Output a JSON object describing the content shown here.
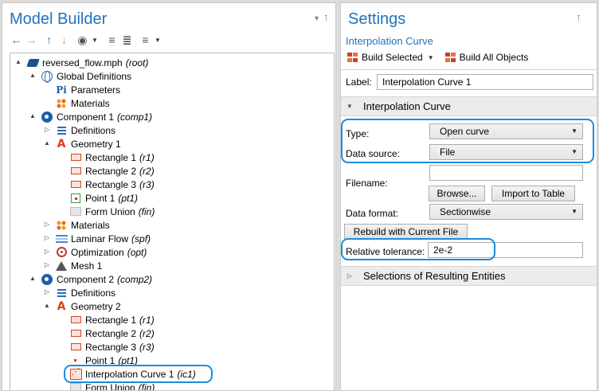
{
  "model_builder": {
    "title": "Model Builder",
    "toolbar": [
      {
        "icon": "arrow-left-icon",
        "glyph": "←"
      },
      {
        "icon": "arrow-right-icon",
        "glyph": "→"
      },
      {
        "icon": "arrow-up-icon",
        "glyph": "↑"
      },
      {
        "icon": "arrow-down-icon",
        "glyph": "↓"
      },
      {
        "icon": "show-icon",
        "glyph": "◉"
      },
      {
        "icon": "expand-sections-icon",
        "glyph": "≡"
      },
      {
        "icon": "collapse-sections-icon",
        "glyph": "≣"
      },
      {
        "icon": "list-view-icon",
        "glyph": "≡"
      }
    ],
    "tree": [
      {
        "label": "reversed_flow.mph",
        "tag": "(root)",
        "icon": "root-icon",
        "toggle": "▲"
      },
      {
        "label": "Global Definitions",
        "tag": "",
        "icon": "globe-icon",
        "toggle": "▲"
      },
      {
        "label": "Parameters",
        "tag": "",
        "icon": "parameters-icon",
        "toggle": ""
      },
      {
        "label": "Materials",
        "tag": "",
        "icon": "materials-icon",
        "toggle": ""
      },
      {
        "label": "Component 1",
        "tag": "(comp1)",
        "icon": "component-icon",
        "toggle": "▲"
      },
      {
        "label": "Definitions",
        "tag": "",
        "icon": "definitions-icon",
        "toggle": "▷"
      },
      {
        "label": "Geometry 1",
        "tag": "",
        "icon": "geometry-icon",
        "toggle": "▲"
      },
      {
        "label": "Rectangle 1",
        "tag": "(r1)",
        "icon": "rectangle-icon",
        "toggle": ""
      },
      {
        "label": "Rectangle 2",
        "tag": "(r2)",
        "icon": "rectangle-icon",
        "toggle": ""
      },
      {
        "label": "Rectangle 3",
        "tag": "(r3)",
        "icon": "rectangle-icon",
        "toggle": ""
      },
      {
        "label": "Point 1",
        "tag": "(pt1)",
        "icon": "point-icon",
        "toggle": ""
      },
      {
        "label": "Form Union",
        "tag": "(fin)",
        "icon": "form-union-icon",
        "toggle": ""
      },
      {
        "label": "Materials",
        "tag": "",
        "icon": "materials-icon",
        "toggle": "▷"
      },
      {
        "label": "Laminar Flow",
        "tag": "(spf)",
        "icon": "laminar-flow-icon",
        "toggle": "▷"
      },
      {
        "label": "Optimization",
        "tag": "(opt)",
        "icon": "optimization-icon",
        "toggle": "▷"
      },
      {
        "label": "Mesh 1",
        "tag": "",
        "icon": "mesh-icon",
        "toggle": "▷"
      },
      {
        "label": "Component 2",
        "tag": "(comp2)",
        "icon": "component-icon",
        "toggle": "▲"
      },
      {
        "label": "Definitions",
        "tag": "",
        "icon": "definitions-icon",
        "toggle": "▷"
      },
      {
        "label": "Geometry 2",
        "tag": "",
        "icon": "geometry-icon",
        "toggle": "▲"
      },
      {
        "label": "Rectangle 1",
        "tag": "(r1)",
        "icon": "rectangle-icon",
        "toggle": ""
      },
      {
        "label": "Rectangle 2",
        "tag": "(r2)",
        "icon": "rectangle-icon",
        "toggle": ""
      },
      {
        "label": "Rectangle 3",
        "tag": "(r3)",
        "icon": "rectangle-icon",
        "toggle": ""
      },
      {
        "label": "Point 1",
        "tag": "(pt1)",
        "icon": "point-icon",
        "toggle": ""
      },
      {
        "label": "Interpolation Curve 1",
        "tag": "(ic1)",
        "icon": "interpolation-curve-icon",
        "toggle": "",
        "selected": true
      },
      {
        "label": "Form Union",
        "tag": "(fin)",
        "icon": "form-union-icon",
        "toggle": ""
      }
    ]
  },
  "settings": {
    "title": "Settings",
    "subtitle": "Interpolation Curve",
    "build_selected": "Build Selected",
    "build_all": "Build All Objects",
    "label_caption": "Label:",
    "label_value": "Interpolation Curve 1",
    "section_interp": "Interpolation Curve",
    "type_caption": "Type:",
    "type_value": "Open curve",
    "source_caption": "Data source:",
    "source_value": "File",
    "filename_caption": "Filename:",
    "filename_value": "",
    "browse": "Browse...",
    "import_table": "Import to Table",
    "format_caption": "Data format:",
    "format_value": "Sectionwise",
    "rebuild": "Rebuild with Current File",
    "tolerance_caption": "Relative tolerance:",
    "tolerance_value": "2e-2",
    "section_selections": "Selections of Resulting Entities"
  },
  "colors": {
    "accent": "#1e73be",
    "callout": "#1a8be0"
  }
}
